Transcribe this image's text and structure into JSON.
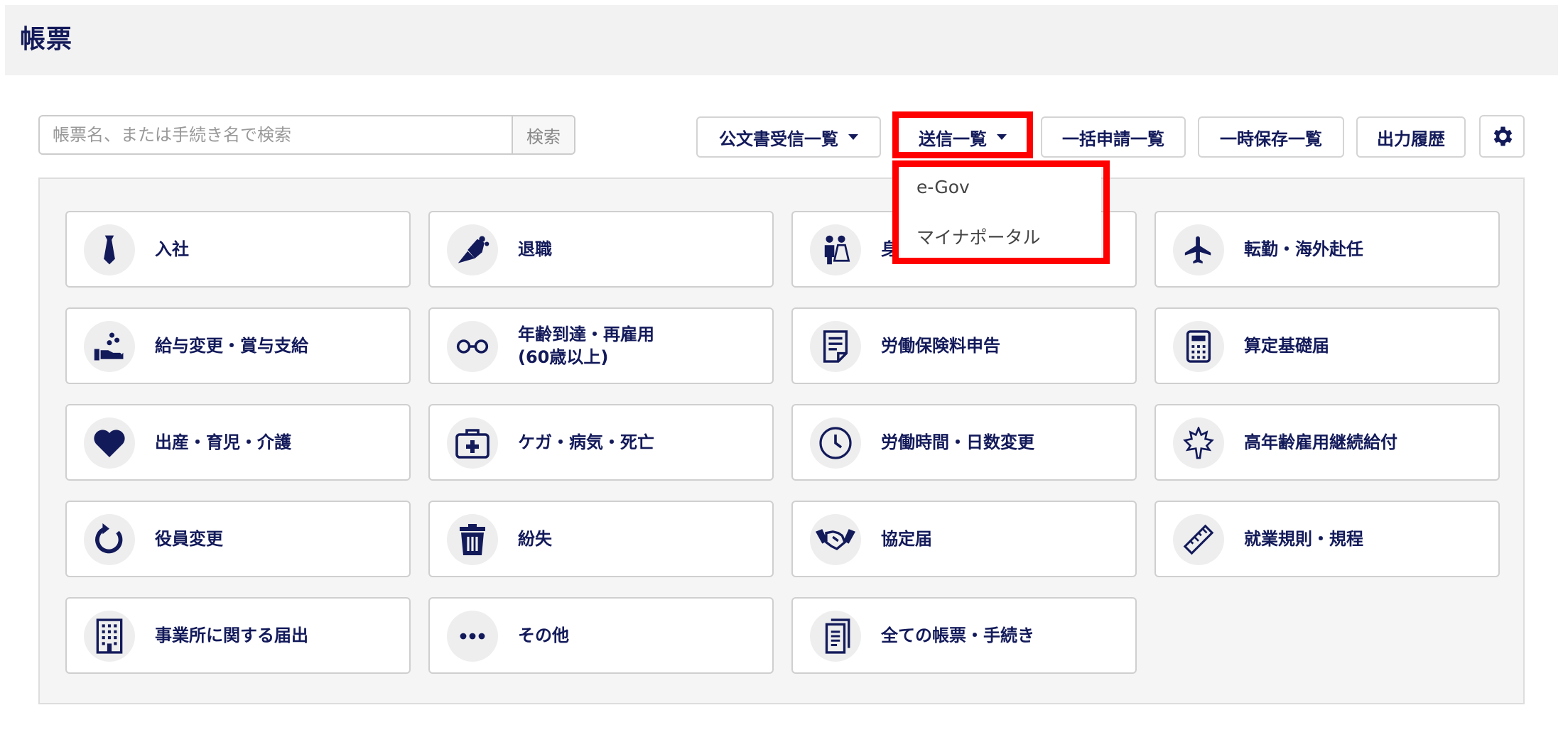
{
  "page": {
    "title": "帳票"
  },
  "search": {
    "placeholder": "帳票名、または手続き名で検索",
    "button_label": "検索"
  },
  "toolbar": {
    "received_label": "公文書受信一覧",
    "sent_label": "送信一覧",
    "bulk_label": "一括申請一覧",
    "saved_label": "一時保存一覧",
    "history_label": "出力履歴"
  },
  "dropdown": {
    "items": [
      "e-Gov",
      "マイナポータル"
    ]
  },
  "cards": [
    {
      "label": "入社",
      "icon": "necktie-icon"
    },
    {
      "label": "退職",
      "icon": "bouquet-icon"
    },
    {
      "label": "身",
      "icon": "wedding-couple-icon"
    },
    {
      "label": "転勤・海外赴任",
      "icon": "airplane-icon"
    },
    {
      "label": "給与変更・賞与支給",
      "icon": "coin-hand-icon"
    },
    {
      "label": "年齢到達・再雇用",
      "label2": "(60歳以上)",
      "icon": "glasses-icon"
    },
    {
      "label": "労働保険料申告",
      "icon": "document-icon"
    },
    {
      "label": "算定基礎届",
      "icon": "calculator-icon"
    },
    {
      "label": "出産・育児・介護",
      "icon": "heart-icon"
    },
    {
      "label": "ケガ・病気・死亡",
      "icon": "first-aid-kit-icon"
    },
    {
      "label": "労働時間・日数変更",
      "icon": "clock-icon"
    },
    {
      "label": "高年齢雇用継続給付",
      "icon": "maple-leaf-icon"
    },
    {
      "label": "役員変更",
      "icon": "refresh-icon"
    },
    {
      "label": "紛失",
      "icon": "trash-icon"
    },
    {
      "label": "協定届",
      "icon": "handshake-icon"
    },
    {
      "label": "就業規則・規程",
      "icon": "ruler-icon"
    },
    {
      "label": "事業所に関する届出",
      "icon": "building-icon"
    },
    {
      "label": "その他",
      "icon": "ellipsis-icon"
    },
    {
      "label": "全ての帳票・手続き",
      "icon": "documents-icon"
    }
  ],
  "colors": {
    "navy": "#131a5a",
    "highlight": "#ff0000"
  }
}
